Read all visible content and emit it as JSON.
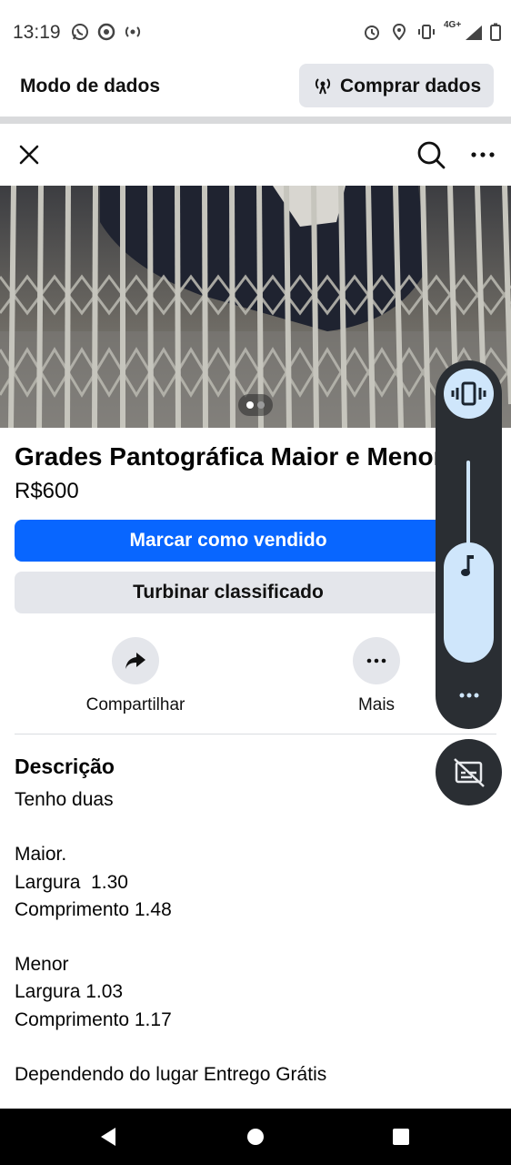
{
  "status_bar": {
    "time": "13:19",
    "left_icons": [
      "whatsapp-icon",
      "chrome-icon",
      "hotspot-icon"
    ],
    "right_icons": [
      "alarm-icon",
      "location-icon",
      "vibrate-icon",
      "signal-icon",
      "battery-icon"
    ],
    "network": "4G+"
  },
  "data_bar": {
    "title": "Modo de dados",
    "buy_button": "Comprar dados",
    "buy_icon": "antenna-icon"
  },
  "header": {
    "icons": [
      "close-icon",
      "search-icon",
      "more-icon"
    ]
  },
  "photo": {
    "image_index": 1,
    "image_count": 2
  },
  "listing": {
    "title": "Grades Pantográfica Maior e Menor",
    "price": "R$600",
    "mark_sold_button": "Marcar como vendido",
    "boost_button": "Turbinar classificado",
    "actions": [
      {
        "label": "Compartilhar",
        "icon": "share-icon"
      },
      {
        "label": "Mais",
        "icon": "more-icon"
      }
    ]
  },
  "description": {
    "heading": "Descrição",
    "lines": [
      "Tenho duas",
      "",
      "Maior.",
      "Largura  1.30",
      "Comprimento 1.48",
      "",
      "Menor",
      "Largura 1.03",
      "Comprimento 1.17",
      "",
      "Dependendo do lugar Entrego Grátis"
    ]
  },
  "volume_overlay": {
    "mode_icon": "vibrate-icon",
    "stream_icon": "music-note-icon",
    "more_icon": "more-icon",
    "caption_icon": "live-caption-off-icon",
    "level": 0.5
  },
  "nav_bar": {
    "icons": [
      "back-icon",
      "home-icon",
      "recents-icon"
    ]
  },
  "colors": {
    "primary": "#0866ff",
    "secondary_button": "#e4e6eb",
    "overlay": "#2a2e33",
    "overlay_accent": "#cfe6fb"
  }
}
